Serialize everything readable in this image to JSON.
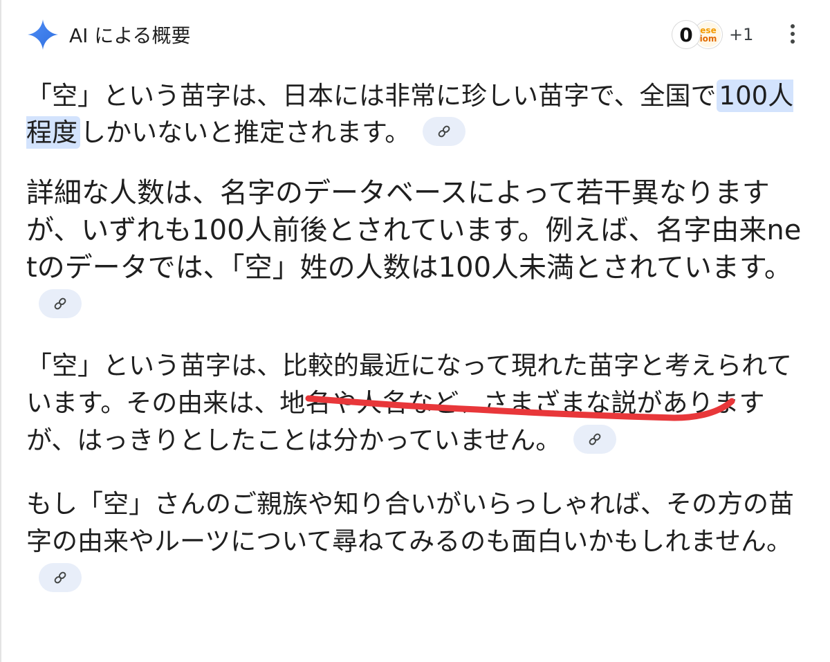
{
  "header": {
    "icon": "sparkle-icon",
    "title": "AI による概要",
    "sources": {
      "avatar1_text": "0",
      "avatar2_line1": "ese",
      "avatar2_line2": "iom",
      "more_count": "+1"
    },
    "menu_icon": "more-vertical-icon"
  },
  "paragraphs": [
    {
      "before": "「空」という苗字は、日本には非常に珍しい苗字で、全国で",
      "highlight": "100人程度",
      "after": "しかいないと推定されます。"
    },
    {
      "text": "詳細な人数は、名字のデータベースによって若干異なりますが、いずれも100人前後とされています。例えば、名字由来netのデータでは、「空」姓の人数は100人未満とされています。"
    },
    {
      "text": "「空」という苗字は、比較的最近になって現れた苗字と考えられています。その由来は、地名や人名など、さまざまな説がありますが、はっきりとしたことは分かっていません。"
    },
    {
      "text": "もし「空」さんのご親族や知り合いがいらっしゃれば、その方の苗字の由来やルーツについて尋ねてみるのも面白いかもしれません。"
    }
  ],
  "colors": {
    "sparkle": "#4285f4",
    "highlight": "#d3e3fd",
    "chip": "#e8eef9",
    "annotation": "#e8373a",
    "text": "#1f1f1f"
  },
  "link_icon": "link-icon"
}
